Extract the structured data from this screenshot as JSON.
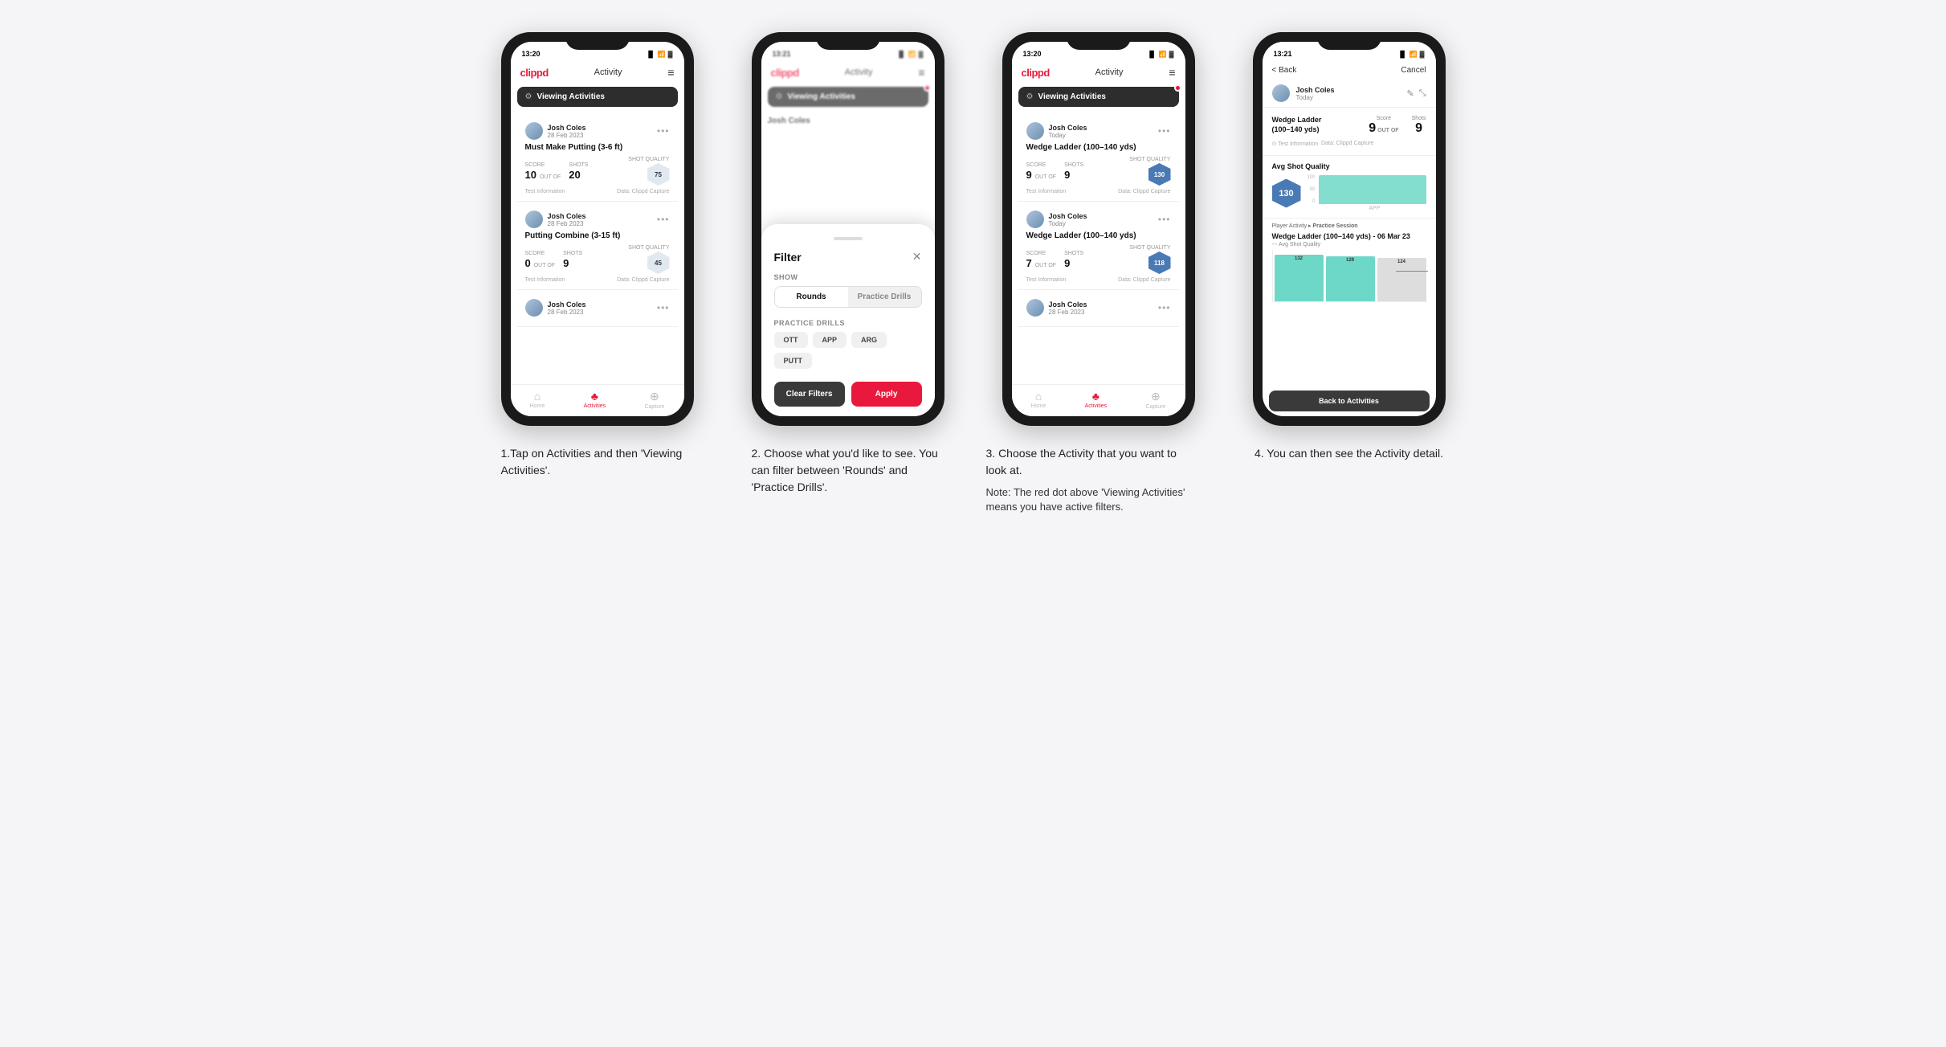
{
  "phones": [
    {
      "id": "phone1",
      "statusTime": "13:20",
      "logoText": "clippd",
      "navTitle": "Activity",
      "viewingBanner": "Viewing Activities",
      "hasRedDot": false,
      "cards": [
        {
          "userName": "Josh Coles",
          "userDate": "28 Feb 2023",
          "activityTitle": "Must Make Putting (3-6 ft)",
          "scoreLabel": "Score",
          "shotsLabel": "Shots",
          "qualityLabel": "Shot Quality",
          "score": "10",
          "outOf": "OUT OF",
          "shots": "20",
          "quality": "75",
          "infoLeft": "Test Information",
          "infoRight": "Data: Clippd Capture"
        },
        {
          "userName": "Josh Coles",
          "userDate": "28 Feb 2023",
          "activityTitle": "Putting Combine (3-15 ft)",
          "scoreLabel": "Score",
          "shotsLabel": "Shots",
          "qualityLabel": "Shot Quality",
          "score": "0",
          "outOf": "OUT OF",
          "shots": "9",
          "quality": "45",
          "infoLeft": "Test Information",
          "infoRight": "Data: Clippd Capture"
        },
        {
          "userName": "Josh Coles",
          "userDate": "28 Feb 2023",
          "activityTitle": "",
          "score": "",
          "shots": "",
          "quality": ""
        }
      ],
      "bottomNav": [
        {
          "label": "Home",
          "icon": "🏠",
          "active": false
        },
        {
          "label": "Activities",
          "icon": "⛳",
          "active": true
        },
        {
          "label": "Capture",
          "icon": "⊕",
          "active": false
        }
      ]
    },
    {
      "id": "phone2",
      "statusTime": "13:21",
      "logoText": "clippd",
      "navTitle": "Activity",
      "viewingBanner": "Viewing Activities",
      "hasRedDot": true,
      "filter": {
        "title": "Filter",
        "showLabel": "Show",
        "toggles": [
          {
            "label": "Rounds",
            "active": true
          },
          {
            "label": "Practice Drills",
            "active": false
          }
        ],
        "drillsLabel": "Practice Drills",
        "chips": [
          {
            "label": "OTT",
            "active": false
          },
          {
            "label": "APP",
            "active": false
          },
          {
            "label": "ARG",
            "active": false
          },
          {
            "label": "PUTT",
            "active": false
          }
        ],
        "clearLabel": "Clear Filters",
        "applyLabel": "Apply"
      }
    },
    {
      "id": "phone3",
      "statusTime": "13:20",
      "logoText": "clippd",
      "navTitle": "Activity",
      "viewingBanner": "Viewing Activities",
      "hasRedDot": true,
      "cards": [
        {
          "userName": "Josh Coles",
          "userDate": "Today",
          "activityTitle": "Wedge Ladder (100–140 yds)",
          "scoreLabel": "Score",
          "shotsLabel": "Shots",
          "qualityLabel": "Shot Quality",
          "score": "9",
          "outOf": "OUT OF",
          "shots": "9",
          "quality": "130",
          "qualityBlue": true,
          "infoLeft": "Test Information",
          "infoRight": "Data: Clippd Capture"
        },
        {
          "userName": "Josh Coles",
          "userDate": "Today",
          "activityTitle": "Wedge Ladder (100–140 yds)",
          "scoreLabel": "Score",
          "shotsLabel": "Shots",
          "qualityLabel": "Shot Quality",
          "score": "7",
          "outOf": "OUT OF",
          "shots": "9",
          "quality": "118",
          "qualityBlue": true,
          "infoLeft": "Test Information",
          "infoRight": "Data: Clippd Capture"
        },
        {
          "userName": "Josh Coles",
          "userDate": "28 Feb 2023",
          "activityTitle": "",
          "score": "",
          "shots": "",
          "quality": ""
        }
      ],
      "bottomNav": [
        {
          "label": "Home",
          "icon": "🏠",
          "active": false
        },
        {
          "label": "Activities",
          "icon": "⛳",
          "active": true
        },
        {
          "label": "Capture",
          "icon": "⊕",
          "active": false
        }
      ]
    },
    {
      "id": "phone4",
      "statusTime": "13:21",
      "logoText": "clippd",
      "backLabel": "< Back",
      "cancelLabel": "Cancel",
      "userName": "Josh Coles",
      "userDate": "Today",
      "drillName": "Wedge Ladder\n(100–140 yds)",
      "scoreLabel": "Score",
      "shotsLabel": "Shots",
      "scoreValue": "9",
      "outOfText": "OUT OF",
      "shotsValue": "9",
      "avgQualityLabel": "Avg Shot Quality",
      "avgQualityValue": "130",
      "chartBars": [
        {
          "value": 130,
          "label": "APP"
        }
      ],
      "yLabels": [
        "100",
        "50",
        "0"
      ],
      "chartLabel": "APP",
      "sessionLabel": "Player Activity",
      "sessionType": "Practice Session",
      "detailTitle": "Wedge Ladder (100–140 yds) - 06 Mar 23",
      "detailSub": "--- Avg Shot Quality",
      "bigBars": [
        {
          "value": 132,
          "label": ""
        },
        {
          "value": 129,
          "label": ""
        },
        {
          "value": 124,
          "label": ""
        }
      ],
      "backToActivities": "Back to Activities"
    }
  ],
  "captions": [
    "1.Tap on Activities and then 'Viewing Activities'.",
    "2. Choose what you'd like to see. You can filter between 'Rounds' and 'Practice Drills'.",
    "3. Choose the Activity that you want to look at.\n\nNote: The red dot above 'Viewing Activities' means you have active filters.",
    "4. You can then see the Activity detail."
  ]
}
